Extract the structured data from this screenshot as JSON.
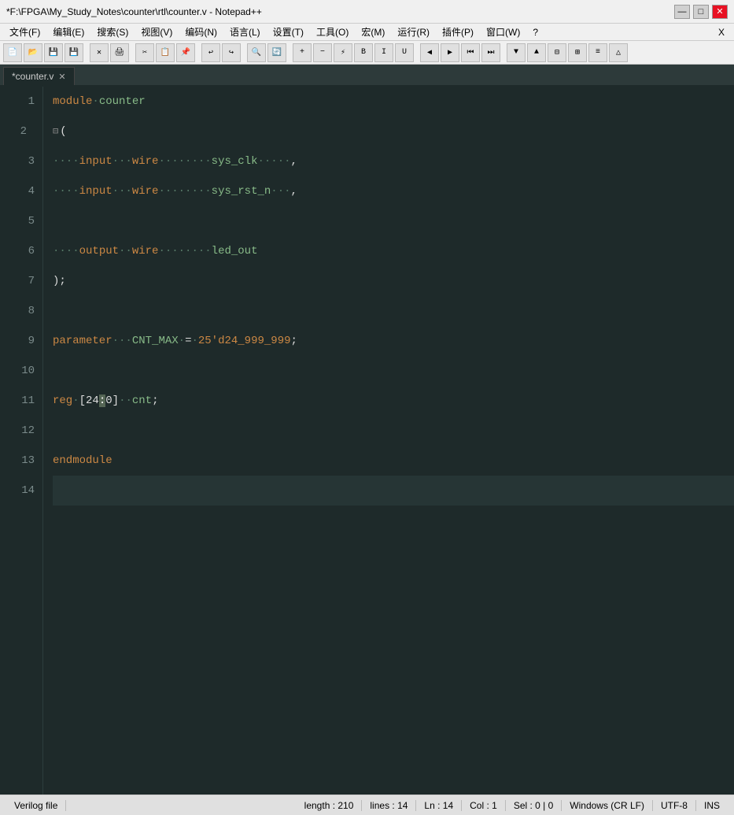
{
  "titlebar": {
    "title": "*F:\\FPGA\\My_Study_Notes\\counter\\rtl\\counter.v - Notepad++",
    "min": "—",
    "max": "□",
    "close": "✕"
  },
  "menubar": {
    "items": [
      "文件(F)",
      "编辑(E)",
      "搜索(S)",
      "视图(V)",
      "编码(N)",
      "语言(L)",
      "设置(T)",
      "工具(O)",
      "宏(M)",
      "运行(R)",
      "插件(P)",
      "窗口(W)",
      "?"
    ],
    "x": "X"
  },
  "tab": {
    "label": "counter.v",
    "close": "✕",
    "modified": true
  },
  "lines": [
    {
      "num": "1",
      "content": "module counter"
    },
    {
      "num": "2",
      "content": "("
    },
    {
      "num": "3",
      "content": "    input   wire        sys_clk     ,"
    },
    {
      "num": "4",
      "content": "    input   wire        sys_rst_n   ,"
    },
    {
      "num": "5",
      "content": ""
    },
    {
      "num": "6",
      "content": "    output  wire        led_out"
    },
    {
      "num": "7",
      "content": ");"
    },
    {
      "num": "8",
      "content": ""
    },
    {
      "num": "9",
      "content": "parameter   CNT_MAX = 25'd24_999_999;"
    },
    {
      "num": "10",
      "content": ""
    },
    {
      "num": "11",
      "content": "reg [24:0]  cnt;"
    },
    {
      "num": "12",
      "content": ""
    },
    {
      "num": "13",
      "content": "endmodule"
    },
    {
      "num": "14",
      "content": ""
    }
  ],
  "statusbar": {
    "file_type": "Verilog file",
    "length": "length : 210",
    "lines": "lines : 14",
    "ln": "Ln : 14",
    "col": "Col : 1",
    "sel": "Sel : 0 | 0",
    "encoding": "Windows (CR LF)",
    "charset": "UTF-8",
    "ins": "INS"
  }
}
